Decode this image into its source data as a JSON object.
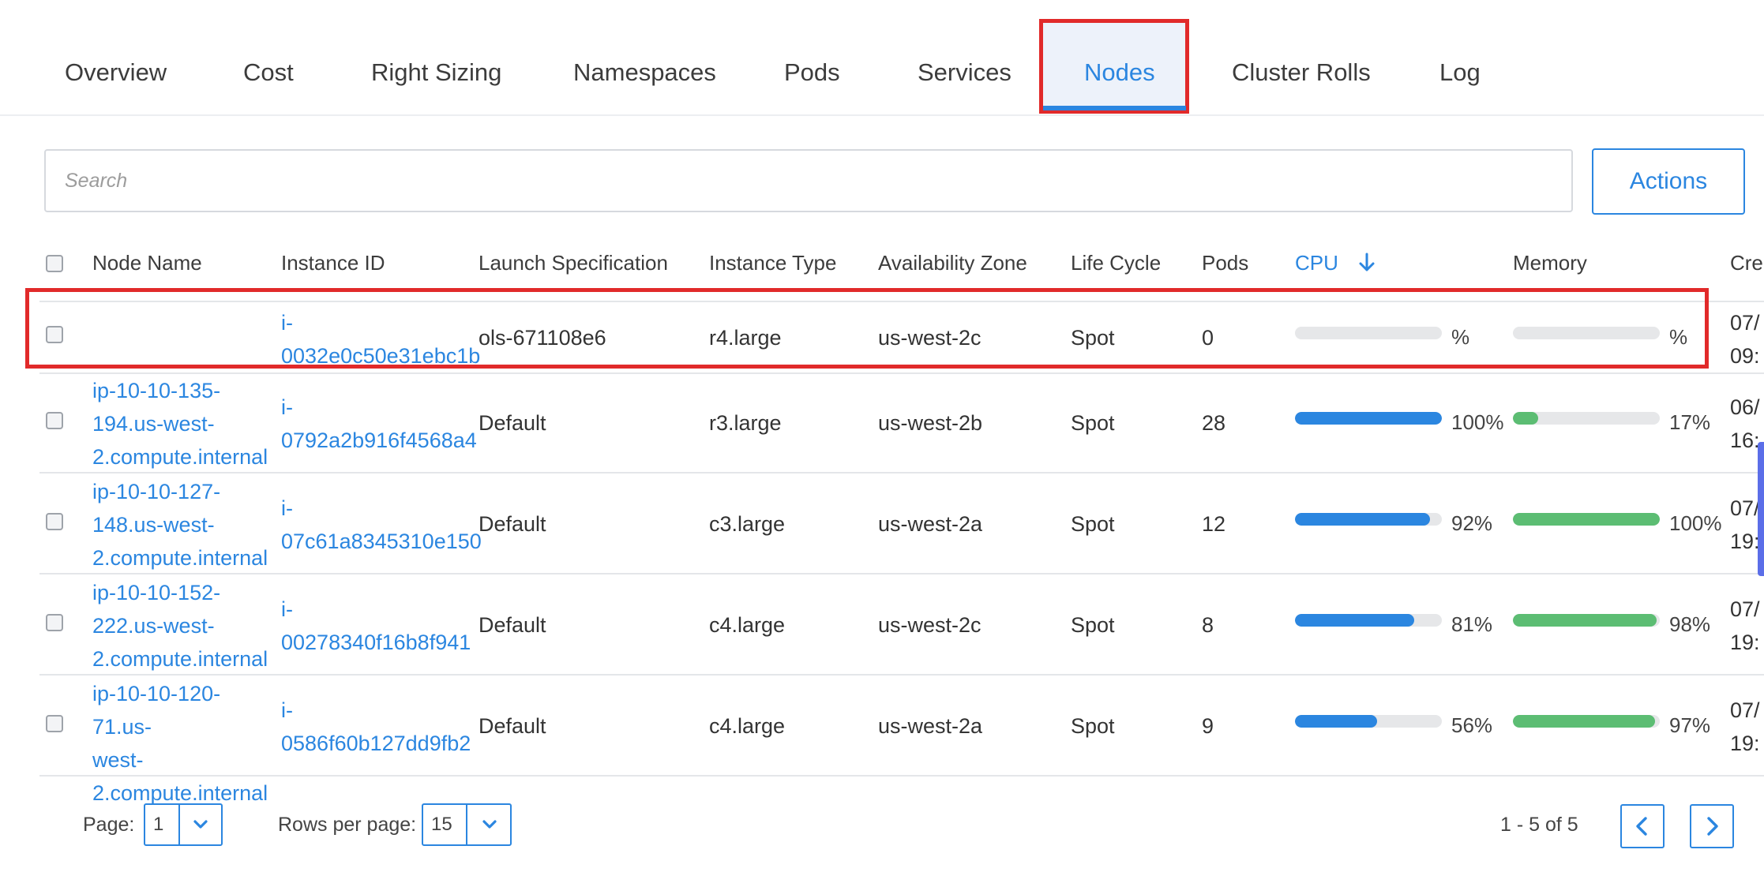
{
  "tabs": [
    {
      "id": "overview",
      "label": "Overview"
    },
    {
      "id": "cost",
      "label": "Cost"
    },
    {
      "id": "right-sizing",
      "label": "Right Sizing"
    },
    {
      "id": "namespaces",
      "label": "Namespaces"
    },
    {
      "id": "pods",
      "label": "Pods"
    },
    {
      "id": "services",
      "label": "Services"
    },
    {
      "id": "nodes",
      "label": "Nodes",
      "active": true
    },
    {
      "id": "cluster-rolls",
      "label": "Cluster Rolls"
    },
    {
      "id": "log",
      "label": "Log"
    }
  ],
  "search": {
    "placeholder": "Search",
    "value": ""
  },
  "actions_label": "Actions",
  "table": {
    "columns": [
      "Node Name",
      "Instance ID",
      "Launch Specification",
      "Instance Type",
      "Availability Zone",
      "Life Cycle",
      "Pods",
      "CPU",
      "Memory",
      "Cre"
    ],
    "sorted_column": "CPU",
    "sort_direction": "descending",
    "rows": [
      {
        "node_name": "",
        "instance_id": "i-0032e0c50e31ebc1b",
        "instance_id_lines": [
          "i-",
          "0032e0c50e31ebc1b"
        ],
        "launch_spec": "ols-671108e6",
        "instance_type": "r4.large",
        "zone": "us-west-2c",
        "life_cycle": "Spot",
        "pods": "0",
        "cpu": "%",
        "cpu_value": 0,
        "memory": "%",
        "memory_value": 0,
        "created": "07/ 09:",
        "created_lines": [
          "07/",
          "09:"
        ],
        "highlighted": true
      },
      {
        "node_name": "ip-10-10-135-194.us-west-2.compute.internal",
        "node_name_lines": [
          "ip-10-10-135-",
          "194.us-west-",
          "2.compute.internal"
        ],
        "instance_id": "i-0792a2b916f4568a4",
        "instance_id_lines": [
          "i-",
          "0792a2b916f4568a4"
        ],
        "launch_spec": "Default",
        "instance_type": "r3.large",
        "zone": "us-west-2b",
        "life_cycle": "Spot",
        "pods": "28",
        "cpu": "100%",
        "cpu_value": 100,
        "memory": "17%",
        "memory_value": 17,
        "created": "06/ 16:",
        "created_lines": [
          "06/",
          "16:"
        ]
      },
      {
        "node_name": "ip-10-10-127-148.us-west-2.compute.internal",
        "node_name_lines": [
          "ip-10-10-127-",
          "148.us-west-",
          "2.compute.internal"
        ],
        "instance_id": "i-07c61a8345310e150",
        "instance_id_lines": [
          "i-",
          "07c61a8345310e150"
        ],
        "launch_spec": "Default",
        "instance_type": "c3.large",
        "zone": "us-west-2a",
        "life_cycle": "Spot",
        "pods": "12",
        "cpu": "92%",
        "cpu_value": 92,
        "memory": "100%",
        "memory_value": 100,
        "created": "07/ 19:",
        "created_lines": [
          "07/",
          "19:"
        ]
      },
      {
        "node_name": "ip-10-10-152-222.us-west-2.compute.internal",
        "node_name_lines": [
          "ip-10-10-152-",
          "222.us-west-",
          "2.compute.internal"
        ],
        "instance_id": "i-00278340f16b8f941",
        "instance_id_lines": [
          "i-",
          "00278340f16b8f941"
        ],
        "launch_spec": "Default",
        "instance_type": "c4.large",
        "zone": "us-west-2c",
        "life_cycle": "Spot",
        "pods": "8",
        "cpu": "81%",
        "cpu_value": 81,
        "memory": "98%",
        "memory_value": 98,
        "created": "07/ 19:",
        "created_lines": [
          "07/",
          "19:"
        ]
      },
      {
        "node_name": "ip-10-10-120-71.us-west-2.compute.internal",
        "node_name_lines": [
          "ip-10-10-120-71.us-",
          "west-",
          "2.compute.internal"
        ],
        "instance_id": "i-0586f60b127dd9fb2",
        "instance_id_lines": [
          "i-",
          "0586f60b127dd9fb2"
        ],
        "launch_spec": "Default",
        "instance_type": "c4.large",
        "zone": "us-west-2a",
        "life_cycle": "Spot",
        "pods": "9",
        "cpu": "56%",
        "cpu_value": 56,
        "memory": "97%",
        "memory_value": 97,
        "created": "07/ 19:",
        "created_lines": [
          "07/",
          "19:"
        ]
      }
    ]
  },
  "pagination": {
    "page_label": "Page:",
    "page_value": "1",
    "rows_label": "Rows per page:",
    "rows_value": "15",
    "range": "1 - 5 of 5"
  },
  "colors": {
    "accent": "#2b86e0",
    "memory": "#5cbd73",
    "highlight": "#e12a2a",
    "track": "#e6e7e9"
  },
  "icons": {
    "sort": "arrow-down-icon",
    "dropdown": "chevron-down-icon",
    "prev": "chevron-left-icon",
    "next": "chevron-right-icon"
  }
}
